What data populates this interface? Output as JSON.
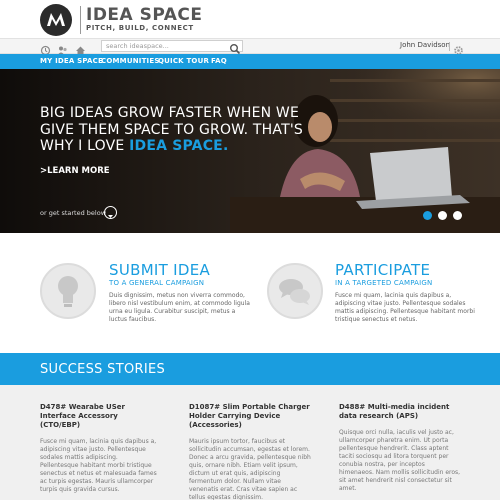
{
  "header": {
    "brand_title": "IDEA SPACE",
    "brand_tagline": "PITCH, BUILD, CONNECT",
    "logo_icon": "motorola-logo-icon"
  },
  "utility": {
    "icons": [
      "clock-icon",
      "people-icon",
      "home-icon"
    ],
    "search_placeholder": "search ideaspace...",
    "user_name": "John Davidson",
    "settings_icon": "gear-icon"
  },
  "nav": {
    "items": [
      "MY IDEA SPACE",
      "COMMUNITIES",
      "QUICK TOUR",
      "FAQ"
    ]
  },
  "hero": {
    "headline_part1": "BIG IDEAS GROW FASTER WHEN WE GIVE THEM SPACE TO GROW. THAT'S WHY I LOVE ",
    "headline_highlight": "IDEA SPACE.",
    "learn_more": ">LEARN MORE",
    "get_started": "or get started below",
    "slides": 3,
    "active_slide": 1
  },
  "actions": [
    {
      "title": "SUBMIT IDEA",
      "subtitle": "TO A GENERAL CAMPAIGN",
      "description": "Duis dignissim, metus non viverra commodo, libero nisl vestibulum enim, at commodo ligula urna eu ligula. Curabitur suscipit, metus a luctus faucibus.",
      "icon": "lightbulb-icon"
    },
    {
      "title": "PARTICIPATE",
      "subtitle": "IN A TARGETED CAMPAIGN",
      "description": "Fusce mi quam, lacinia quis dapibus a, adipiscing vitae justo. Pellentesque sodales mattis adipiscing. Pellentesque habitant morbi tristique senectus et netus.",
      "icon": "chat-bubbles-icon"
    }
  ],
  "stories": {
    "title": "SUCCESS STORIES",
    "items": [
      {
        "title": "D478# Wearabe USer Interface Accessory (CTO/EBP)",
        "body": "Fusce mi quam, lacinia quis dapibus a, adipiscing vitae justo. Pellentesque sodales mattis adipiscing. Pellentesque habitant morbi tristique senectus et netus et malesuada fames ac turpis egestas. Mauris ullamcorper turpis quis gravida cursus."
      },
      {
        "title": "D1087# Slim Portable Charger Holder Carrying Device (Accessories)",
        "body": "Mauris ipsum tortor, faucibus et sollicitudin accumsan, egestas et lorem. Donec a arcu gravida, pellentesque nibh quis, ornare nibh. Etiam velit ipsum, dictum ut erat quis, adipiscing fermentum dolor. Nullam vitae venenatis erat. Cras vitae sapien ac tellus egestas dignissim."
      },
      {
        "title": "D488# Multi-media incident data research (APS)",
        "body": "Quisque orci nulla, iaculis vel justo ac, ullamcorper pharetra enim. Ut porta pellentesque hendrerit. Class aptent taciti sociosqu ad litora torquent per conubia nostra, per inceptos himenaeos. Nam mollis sollicitudin eros, sit amet hendrerit nisl consectetur sit amet."
      }
    ]
  },
  "colors": {
    "accent": "#1a9ddf",
    "dark": "#2b2b2b",
    "panel": "#f0f0f0"
  }
}
